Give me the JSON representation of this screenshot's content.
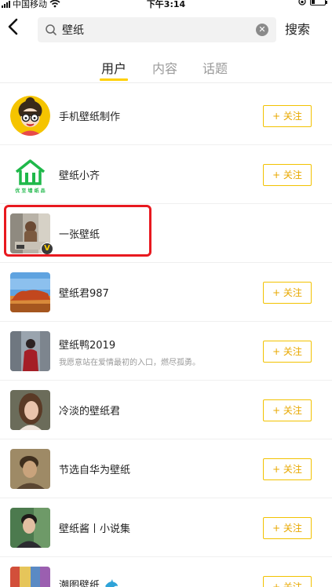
{
  "status_bar": {
    "carrier": "中国移动",
    "time": "下午3:14"
  },
  "search": {
    "query": "壁纸",
    "submit_label": "搜索"
  },
  "tabs": [
    {
      "label": "用户",
      "active": true
    },
    {
      "label": "内容",
      "active": false
    },
    {
      "label": "话题",
      "active": false
    }
  ],
  "users": [
    {
      "name": "手机壁纸制作",
      "desc": "",
      "follow_label": "+ 关注",
      "avatar": "cartoon-girl-glasses"
    },
    {
      "name": "壁纸小齐",
      "desc": "",
      "follow_label": "+ 关注",
      "avatar": "green-house-logo",
      "avatar_text": "优 至 墙 纸 品"
    },
    {
      "name": "一张壁纸",
      "desc": "",
      "follow_label": "",
      "avatar": "street-photo",
      "verified": true,
      "highlighted": true
    },
    {
      "name": "壁纸君987",
      "desc": "",
      "follow_label": "+ 关注",
      "avatar": "red-rock-landscape"
    },
    {
      "name": "壁纸鸭2019",
      "desc": "我愿意站在爱情最初的入口，燃尽孤勇。",
      "follow_label": "+ 关注",
      "avatar": "city-street-person"
    },
    {
      "name": "冷淡的壁纸君",
      "desc": "",
      "follow_label": "+ 关注",
      "avatar": "woman-portrait"
    },
    {
      "name": "节选自华为壁纸",
      "desc": "",
      "follow_label": "+ 关注",
      "avatar": "man-portrait-sepia"
    },
    {
      "name": "壁纸酱丨小说集",
      "desc": "",
      "follow_label": "+ 关注",
      "avatar": "man-portrait-green"
    },
    {
      "name": "潮图壁纸",
      "desc": "",
      "follow_label": "+ 关注",
      "avatar": "colorful-street",
      "emoji": "dolphin-icon"
    }
  ],
  "colors": {
    "accent": "#ffd000",
    "follow_text": "#e8a800",
    "highlight": "#e8191f"
  }
}
